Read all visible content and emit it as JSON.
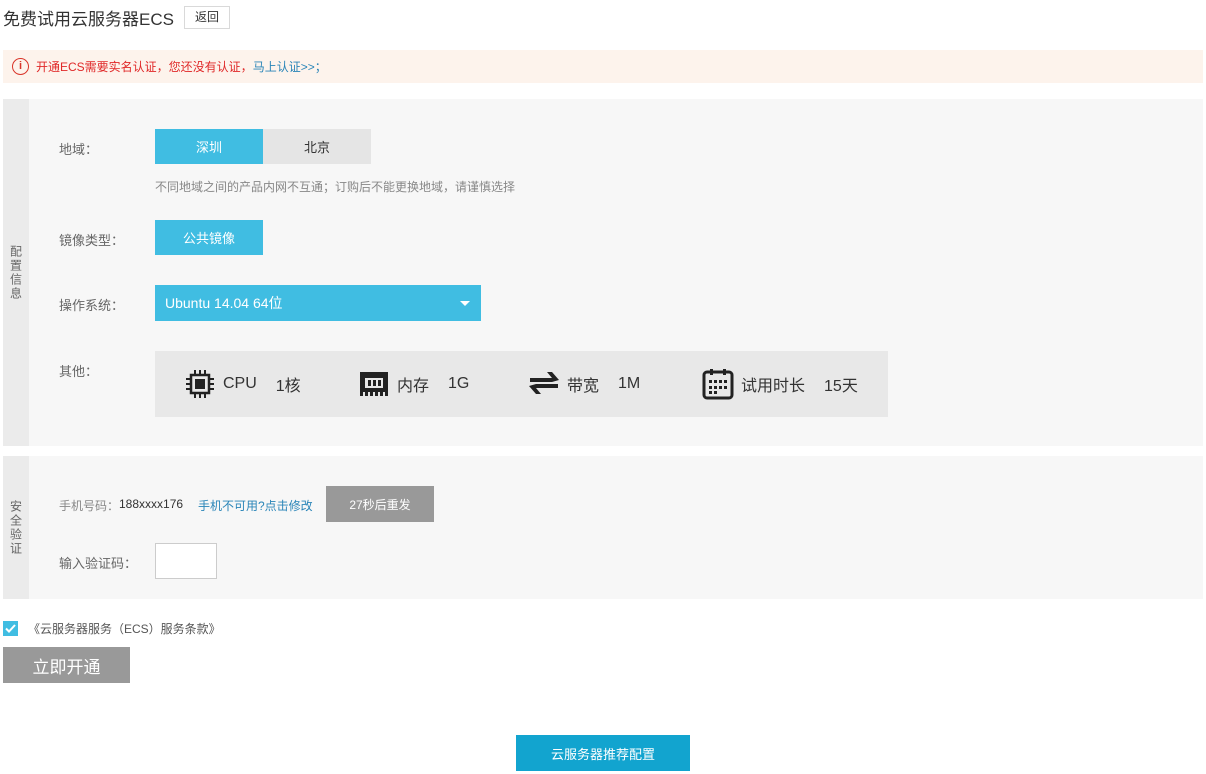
{
  "header": {
    "title": "免费试用云服务器ECS",
    "back_label": "返回"
  },
  "alert": {
    "message": "开通ECS需要实名认证，您还没有认证，",
    "link": "马上认证>>；"
  },
  "config_panel": {
    "side_label": "配置信息",
    "region": {
      "label": "地域：",
      "options": [
        "深圳",
        "北京"
      ],
      "selected": "深圳",
      "hint": "不同地域之间的产品内网不互通；订购后不能更换地域，请谨慎选择"
    },
    "image_type": {
      "label": "镜像类型：",
      "value": "公共镜像"
    },
    "os": {
      "label": "操作系统：",
      "value": "Ubuntu 14.04 64位"
    },
    "other": {
      "label": "其他：",
      "specs": [
        {
          "icon": "cpu-icon",
          "name": "CPU",
          "value": "1核"
        },
        {
          "icon": "memory-icon",
          "name": "内存",
          "value": "1G"
        },
        {
          "icon": "bandwidth-icon",
          "name": "带宽",
          "value": "1M"
        },
        {
          "icon": "calendar-icon",
          "name": "试用时长",
          "value": "15天"
        }
      ]
    }
  },
  "security_panel": {
    "side_label": "安全验证",
    "phone_label": "手机号码：",
    "phone_number": "188xxxx176",
    "change_link": "手机不可用?点击修改",
    "resend_label": "27秒后重发",
    "code_label": "输入验证码：",
    "code_value": ""
  },
  "terms": {
    "checked": true,
    "label": "《云服务器服务（ECS）服务条款》"
  },
  "activate_label": "立即开通",
  "recommend_label": "云服务器推荐配置",
  "colors": {
    "accent": "#40bde2",
    "disabled": "#999999",
    "alert_bg": "#fdf3ec",
    "alert_text": "#e02828",
    "link": "#2a85b8"
  }
}
